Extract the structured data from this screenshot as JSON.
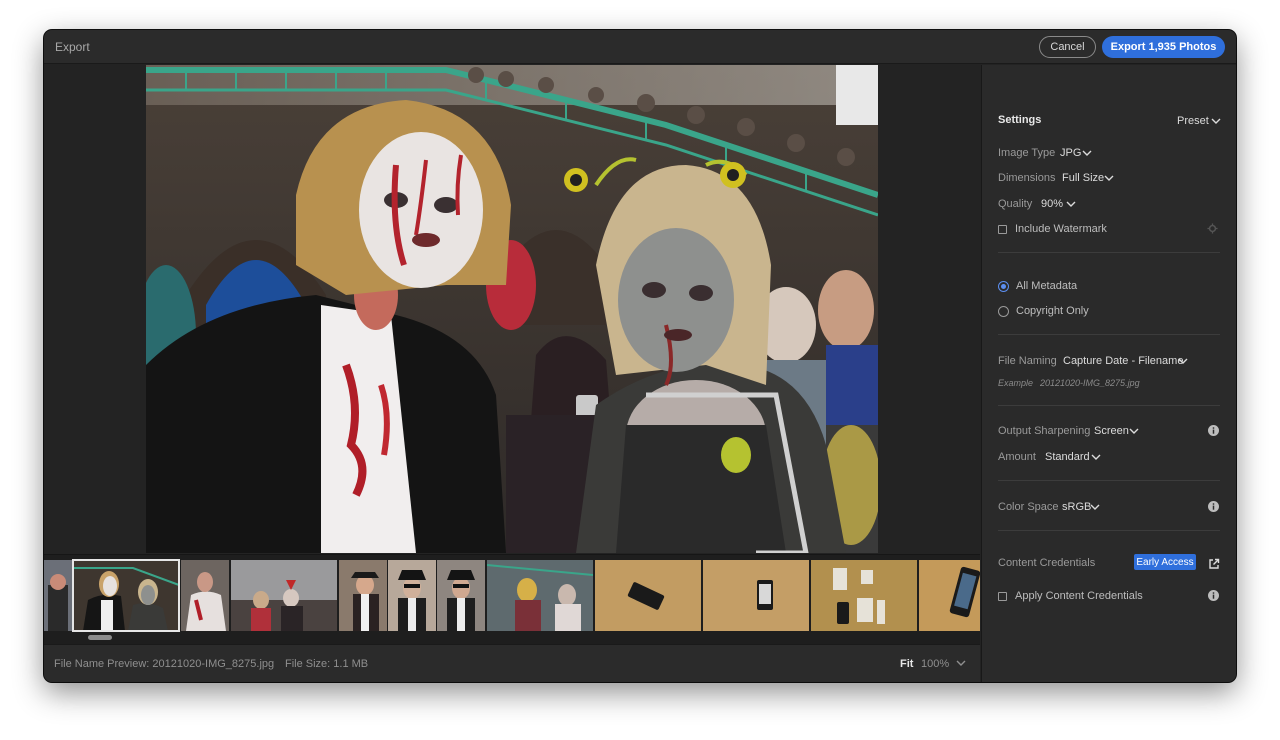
{
  "window": {
    "title": "Export",
    "cancel_label": "Cancel",
    "export_label": "Export 1,935 Photos"
  },
  "colors": {
    "accent": "#2f6fdc",
    "panel_bg": "#2a2a2a",
    "window_bg": "#232323"
  },
  "settings": {
    "header": "Settings",
    "preset_label": "Preset",
    "image_type": {
      "label": "Image Type",
      "value": "JPG"
    },
    "dimensions": {
      "label": "Dimensions",
      "value": "Full Size"
    },
    "quality": {
      "label": "Quality",
      "value": "90%"
    },
    "include_watermark": {
      "label": "Include Watermark",
      "checked": false
    },
    "metadata": {
      "options": [
        {
          "label": "All Metadata",
          "selected": true
        },
        {
          "label": "Copyright Only",
          "selected": false
        }
      ]
    },
    "file_naming": {
      "label": "File Naming",
      "value": "Capture Date - Filename",
      "example_label": "Example",
      "example_value": "20121020-IMG_8275.jpg"
    },
    "output_sharpening": {
      "label": "Output Sharpening",
      "value": "Screen"
    },
    "amount": {
      "label": "Amount",
      "value": "Standard"
    },
    "color_space": {
      "label": "Color Space",
      "value": "sRGB"
    },
    "content_credentials": {
      "label": "Content Credentials",
      "badge": "Early Access",
      "apply_label": "Apply Content Credentials",
      "apply_checked": false
    }
  },
  "status": {
    "file_name_preview": "File Name Preview: 20121020-IMG_8275.jpg",
    "file_size": "File Size: 1.1 MB",
    "fit_label": "Fit",
    "zoom_label": "100%"
  },
  "filmstrip": {
    "selected_index": 1,
    "thumbnail_count": 13
  }
}
